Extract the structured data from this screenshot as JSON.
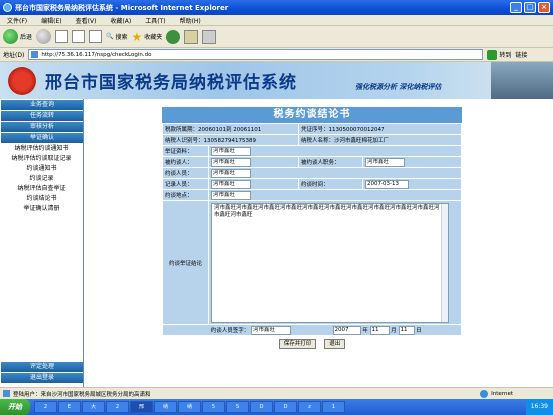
{
  "window": {
    "title": "邢台市国家税务局纳税评估系统 - Microsoft Internet Explorer"
  },
  "menu": [
    "文件(F)",
    "编辑(E)",
    "查看(V)",
    "收藏(A)",
    "工具(T)",
    "帮助(H)"
  ],
  "toolbar": {
    "back": "后退",
    "search": "搜索",
    "favorites": "收藏夹"
  },
  "address": {
    "label": "地址(D)",
    "url": "http://75.36.16.117/nspg/checkLogin.do",
    "go": "转到",
    "links": "链接"
  },
  "banner": {
    "title": "邢台市国家税务局纳税评估系统",
    "slogan": "强化税源分析   深化纳税评估"
  },
  "sidebar": {
    "top_buttons": [
      "业务查询",
      "任务流转",
      "审核分析",
      "举证确认"
    ],
    "links": [
      "纳税评估约谈通知书",
      "纳税评估约谈取证记录",
      "约谈通知书",
      "约谈记录",
      "纳税评估自查举证",
      "约谈结论书",
      "举证确认清册"
    ],
    "bottom_buttons": [
      "评定处理",
      "退出登录"
    ]
  },
  "form": {
    "title": "税务约谈结论书",
    "period_label": "税款所属期：",
    "period_value": "20060101到 20061101",
    "cert_label": "凭证序号：",
    "cert_value": "1130500070012047",
    "taxid_label": "纳税人识别号：",
    "taxid_value": "130582794175389",
    "taxname_label": "纳税人名称：",
    "taxname_value": "沙河市鑫旺棉花加工厂",
    "evidence_label": "举证资料：",
    "evidence_value": "河市鑫旺",
    "interviewee_label": "被约谈人：",
    "interviewee_value": "河市鑫旺",
    "duty_label": "被约谈人职务：",
    "duty_value": "河市鑫旺",
    "interviewer_label": "约谈人员：",
    "interviewer_value": "河市鑫旺",
    "recorder_label": "记录人员：",
    "recorder_value": "河市鑫旺",
    "time_label": "约谈时间：",
    "time_value": "2007-03-13",
    "place_label": "约谈地点：",
    "place_value": "河市鑫旺",
    "conclusion_label": "约谈举证结论",
    "conclusion_value": "河市鑫旺河市鑫旺河市鑫旺河市鑫旺河市鑫旺河市鑫旺河市鑫旺河市鑫旺河市鑫旺河市鑫旺河市鑫旺河市鑫旺",
    "sign_label": "约谈人员签字：",
    "sign_value": "河市鑫旺",
    "year_value": "2007",
    "year_unit": "年",
    "month_value": "11",
    "month_unit": "月",
    "day_value": "11",
    "day_unit": "日",
    "save_print": "保存并打印",
    "exit": "退出"
  },
  "status": {
    "text": "登陆用户：来自沙河市国家税务局城区税务分局的高潇和",
    "zone": "Internet"
  },
  "taskbar": {
    "start": "开始",
    "tasks": [
      "2",
      "E",
      "大",
      "2",
      "邢",
      "纳",
      "纳",
      "5",
      "S",
      "D",
      "D",
      "z",
      "1"
    ],
    "clock": "16:39"
  },
  "colors": {
    "form_header": "#5b9bd5",
    "form_bg": "#b7d3ec",
    "side_button": "#1d5f9c",
    "banner_text": "#0c3a8a"
  }
}
